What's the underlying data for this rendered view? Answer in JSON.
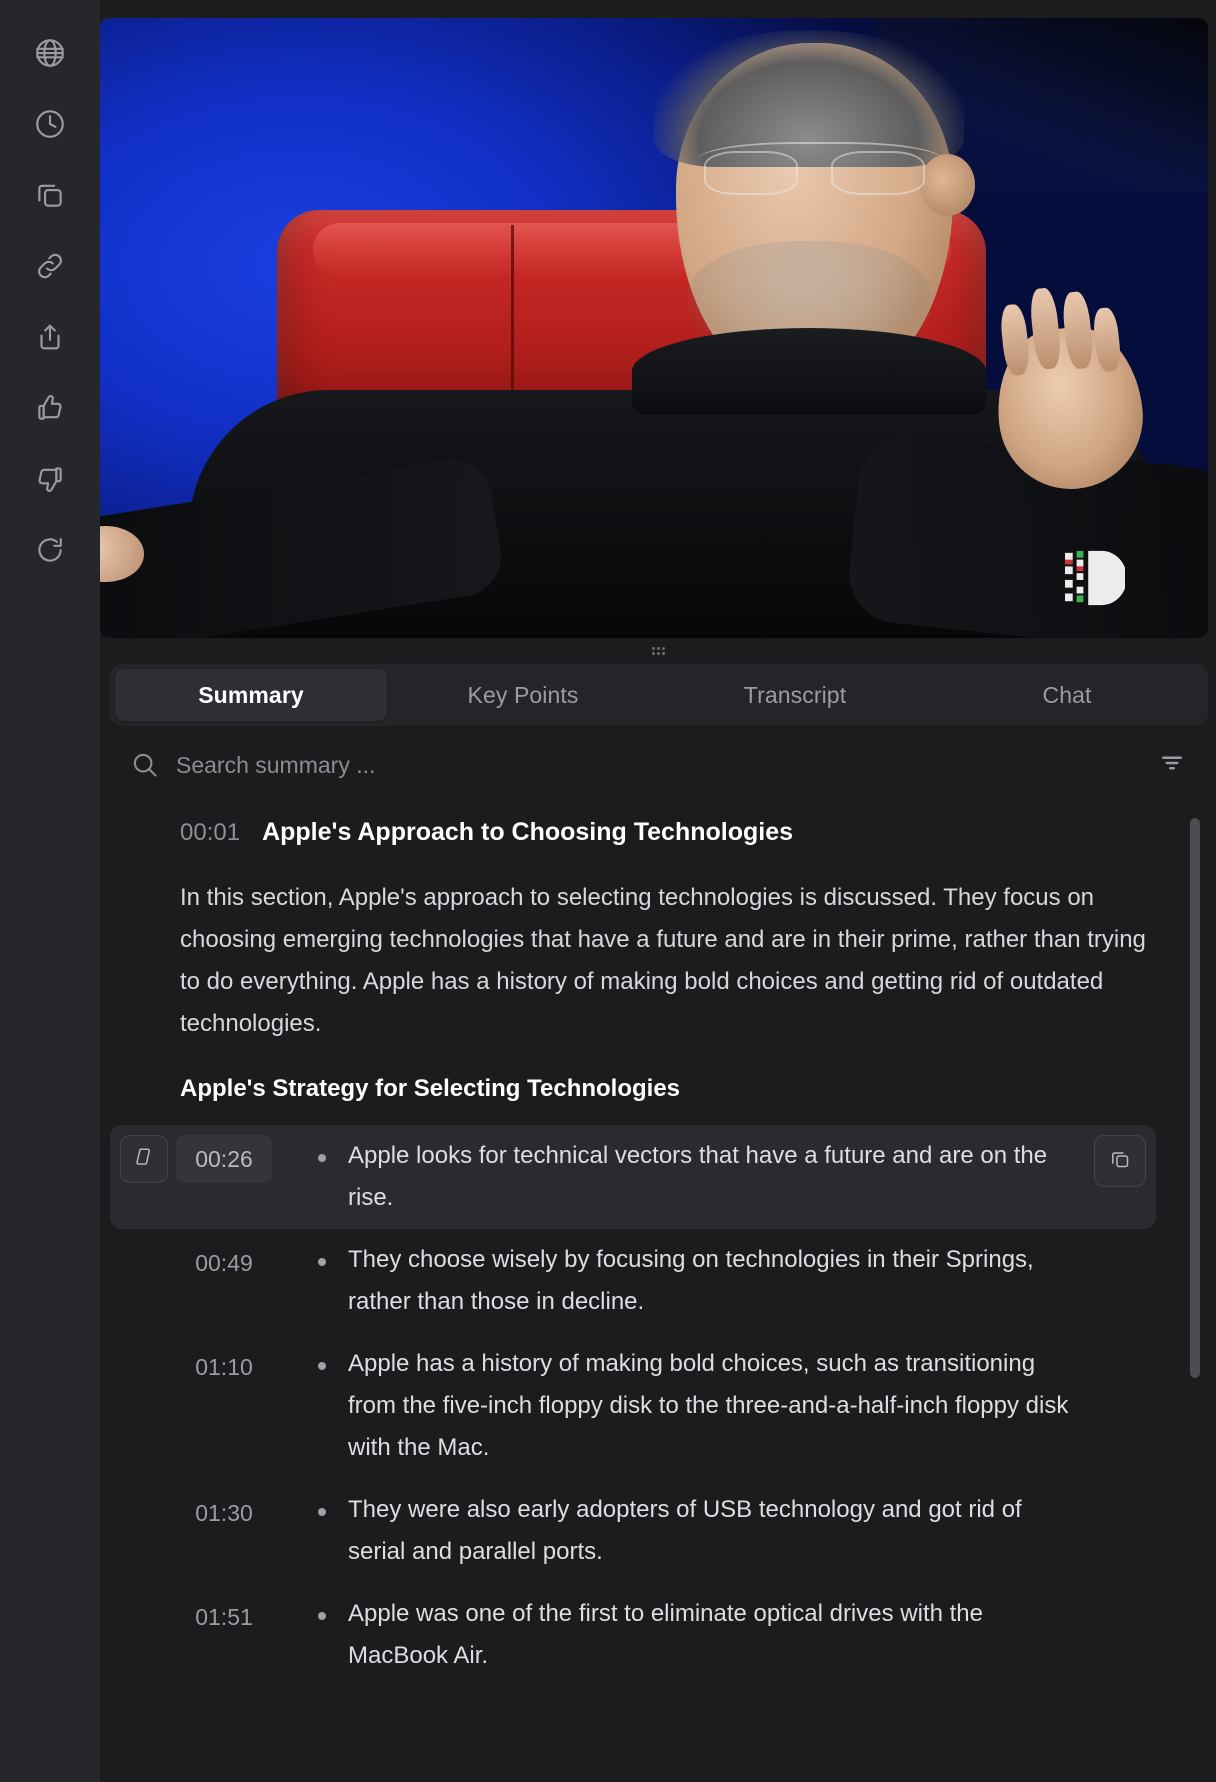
{
  "rail": {
    "items": [
      {
        "name": "globe-icon",
        "label": "Language"
      },
      {
        "name": "clock-icon",
        "label": "History"
      },
      {
        "name": "copy-icon",
        "label": "Duplicate"
      },
      {
        "name": "link-icon",
        "label": "Copy link"
      },
      {
        "name": "share-icon",
        "label": "Share"
      },
      {
        "name": "thumbs-up-icon",
        "label": "Like"
      },
      {
        "name": "thumbs-down-icon",
        "label": "Dislike"
      },
      {
        "name": "refresh-icon",
        "label": "Regenerate"
      }
    ]
  },
  "video": {
    "watermark": "D",
    "alt": "Speaker in a black turtleneck seated in a red chair on a blue-lit stage"
  },
  "tabs": [
    {
      "label": "Summary",
      "active": true
    },
    {
      "label": "Key Points",
      "active": false
    },
    {
      "label": "Transcript",
      "active": false
    },
    {
      "label": "Chat",
      "active": false
    }
  ],
  "search": {
    "placeholder": "Search summary ...",
    "value": "",
    "icon": "search-icon",
    "filter_icon": "filter-icon"
  },
  "summary": {
    "section_time": "00:01",
    "section_title": "Apple's Approach to Choosing Technologies",
    "section_body": "In this section, Apple's approach to selecting technologies is discussed. They focus on choosing emerging technologies that have a future and are in their prime, rather than trying to do everything. Apple has a history of making bold choices and getting rid of outdated technologies.",
    "sub_title": "Apple's Strategy for Selecting Technologies",
    "bullets": [
      {
        "time": "00:26",
        "text": "Apple looks for technical vectors that have a future and are on the rise.",
        "active": true
      },
      {
        "time": "00:49",
        "text": "They choose wisely by focusing on technologies in their Springs, rather than those in decline.",
        "active": false
      },
      {
        "time": "01:10",
        "text": "Apple has a history of making bold choices, such as transitioning from the five-inch floppy disk to the three-and-a-half-inch floppy disk with the Mac.",
        "active": false
      },
      {
        "time": "01:30",
        "text": "They were also early adopters of USB technology and got rid of serial and parallel ports.",
        "active": false
      },
      {
        "time": "01:51",
        "text": "Apple was one of the first to eliminate optical drives with the MacBook Air.",
        "active": false
      }
    ]
  },
  "colors": {
    "app_bg": "#1c1c1f",
    "rail_bg": "#26272b",
    "panel_bg": "#242529",
    "active_tab_bg": "#2e2f35",
    "active_row_bg": "#2a2b31",
    "text_primary": "#ffffff",
    "text_secondary": "#d7d8dd",
    "text_muted": "#8e8f97",
    "icon_stroke": "#9a9ba3",
    "scrollbar": "#4c4d54"
  }
}
